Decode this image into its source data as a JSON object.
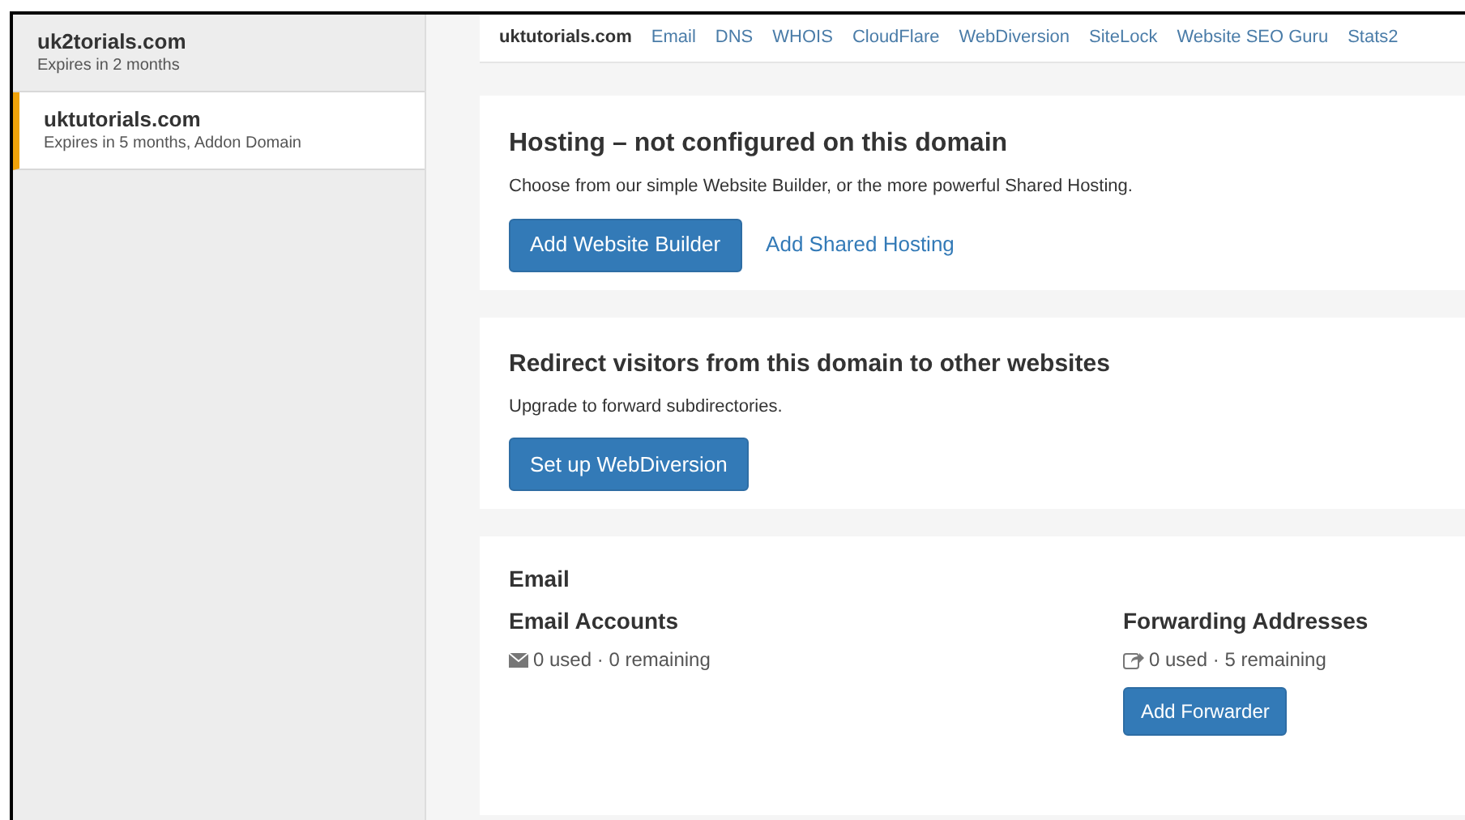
{
  "sidebar": {
    "items": [
      {
        "domain": "uk2torials.com",
        "detail": "Expires in 2 months",
        "selected": false
      },
      {
        "domain": "uktutorials.com",
        "detail": "Expires in 5 months, Addon Domain",
        "selected": true
      }
    ]
  },
  "nav": {
    "title": "uktutorials.com",
    "links": [
      "Email",
      "DNS",
      "WHOIS",
      "CloudFlare",
      "WebDiversion",
      "SiteLock",
      "Website SEO Guru",
      "Stats2"
    ]
  },
  "hosting": {
    "title": "Hosting – not configured on this domain",
    "text": "Choose from our simple Website Builder, or the more powerful Shared Hosting.",
    "button": "Add Website Builder",
    "link": "Add Shared Hosting"
  },
  "redirect": {
    "title": "Redirect visitors from this domain to other websites",
    "text": "Upgrade to forward subdirectories.",
    "button": "Set up WebDiversion"
  },
  "email": {
    "title": "Email",
    "accounts": {
      "title": "Email Accounts",
      "usage": "0 used · 0 remaining"
    },
    "forwarding": {
      "title": "Forwarding Addresses",
      "usage": "0 used · 5 remaining",
      "button": "Add Forwarder"
    }
  }
}
